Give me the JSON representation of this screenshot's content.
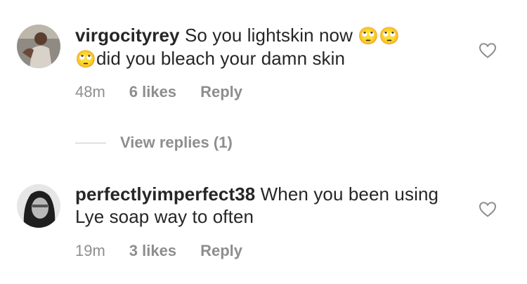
{
  "comments": [
    {
      "username": "virgocityrey",
      "text_part1": "So you lightskin now",
      "emoji": "🙄",
      "text_part2": "did you bleach your damn skin",
      "time": "48m",
      "likes": "6 likes",
      "reply_label": "Reply",
      "view_replies_label": "View replies (1)"
    },
    {
      "username": "perfectlyimperfect38",
      "text": "When you been using Lye soap way to often",
      "time": "19m",
      "likes": "3 likes",
      "reply_label": "Reply"
    }
  ],
  "colors": {
    "text": "#262626",
    "muted": "#8e8e8e",
    "divider": "#c7c7c7"
  },
  "icons": {
    "like": "heart-outline-icon"
  }
}
